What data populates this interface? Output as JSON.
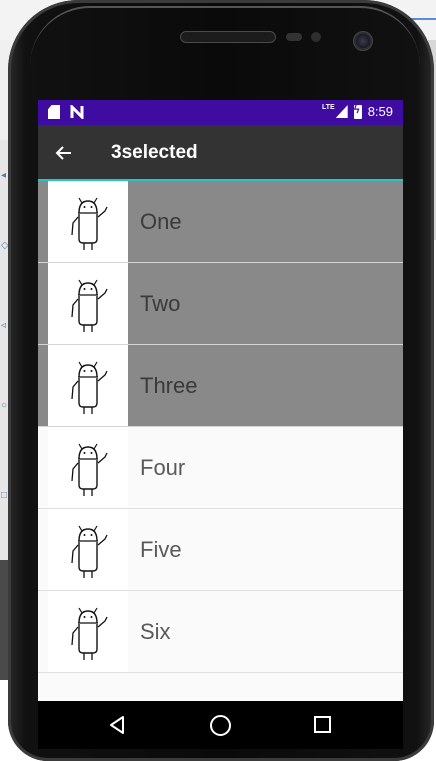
{
  "status_bar": {
    "time": "8:59",
    "network": "LTE",
    "icons": [
      "sd-card-icon",
      "n-notification-icon",
      "signal-icon",
      "battery-charging-icon"
    ]
  },
  "app_bar": {
    "title": "3selected",
    "back_icon": "arrow-left-icon"
  },
  "list": {
    "items": [
      {
        "label": "One",
        "selected": true,
        "icon": "android-robot-icon"
      },
      {
        "label": "Two",
        "selected": true,
        "icon": "android-robot-icon"
      },
      {
        "label": "Three",
        "selected": true,
        "icon": "android-robot-icon"
      },
      {
        "label": "Four",
        "selected": false,
        "icon": "android-robot-icon"
      },
      {
        "label": "Five",
        "selected": false,
        "icon": "android-robot-icon"
      },
      {
        "label": "Six",
        "selected": false,
        "icon": "android-robot-icon"
      }
    ]
  },
  "nav_bar": {
    "buttons": [
      "back-triangle-icon",
      "home-circle-icon",
      "recents-square-icon"
    ]
  },
  "colors": {
    "status_bar": "#3f0ca1",
    "app_bar": "#333333",
    "accent_line": "#26c6c6",
    "selected_row": "#898989"
  }
}
